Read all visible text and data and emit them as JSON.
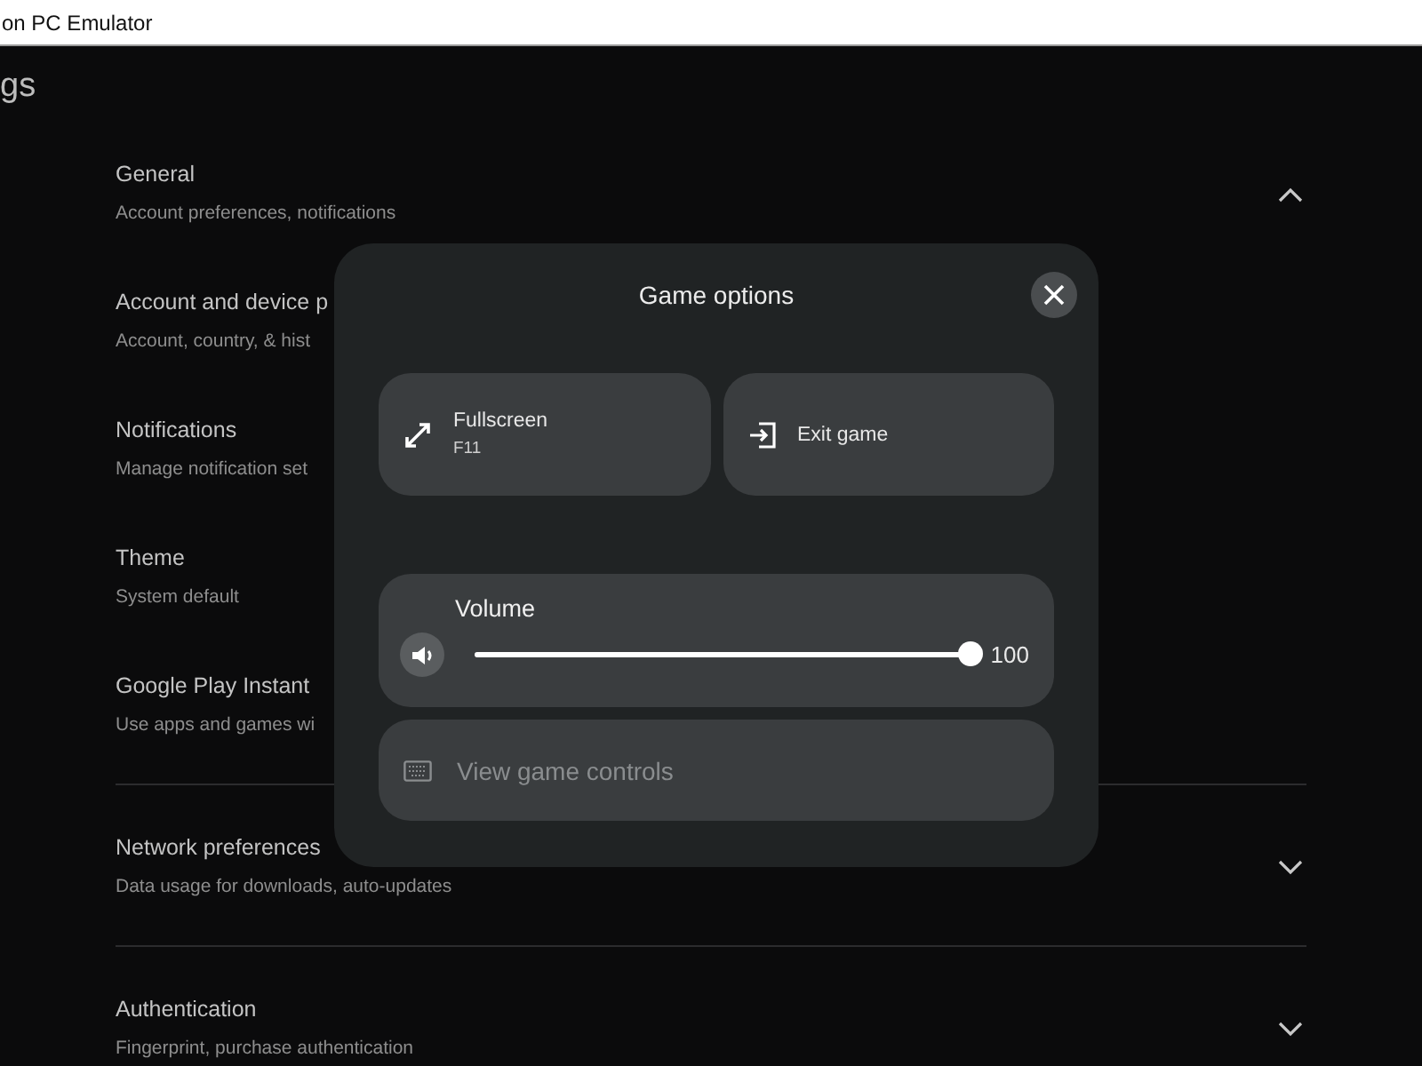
{
  "window": {
    "title": "on PC Emulator"
  },
  "page": {
    "heading": "gs"
  },
  "sections": [
    {
      "title": "General",
      "subtitle": "Account preferences, notifications",
      "expanded": true,
      "items": [
        {
          "title": "Account and device p",
          "subtitle": "Account, country, & hist"
        },
        {
          "title": "Notifications",
          "subtitle": "Manage notification set"
        },
        {
          "title": "Theme",
          "subtitle": "System default"
        },
        {
          "title": "Google Play Instant",
          "subtitle": "Use apps and games wi"
        }
      ]
    },
    {
      "title": "Network preferences",
      "subtitle": "Data usage for downloads, auto-updates",
      "expanded": false
    },
    {
      "title": "Authentication",
      "subtitle": "Fingerprint, purchase authentication",
      "expanded": false
    }
  ],
  "dialog": {
    "title": "Game options",
    "actions": [
      {
        "kind": "fullscreen",
        "label": "Fullscreen",
        "shortcut": "F11"
      },
      {
        "kind": "exit",
        "label": "Exit game"
      }
    ],
    "volume": {
      "label": "Volume",
      "level": 1.0,
      "reading": "100"
    },
    "controls_button": {
      "label": "View game controls",
      "disabled": true
    }
  }
}
